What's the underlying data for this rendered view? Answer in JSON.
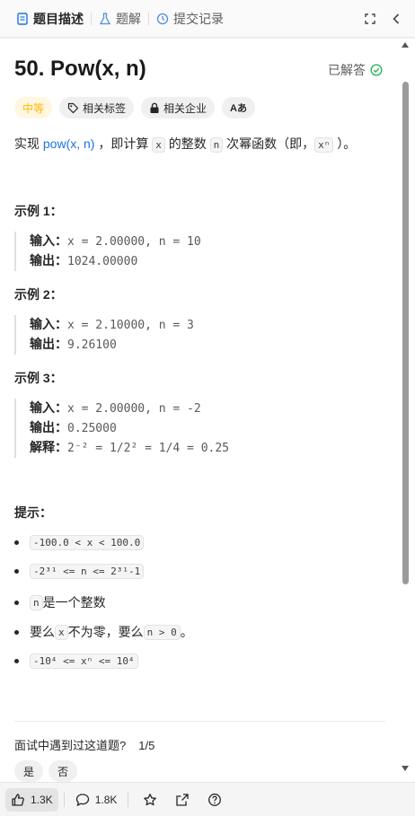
{
  "tabs": [
    {
      "label": "题目描述",
      "icon": "description-icon"
    },
    {
      "label": "题解",
      "icon": "flask-icon"
    },
    {
      "label": "提交记录",
      "icon": "history-icon"
    }
  ],
  "problem": {
    "title": "50. Pow(x, n)",
    "status": "已解答",
    "tags": {
      "difficulty": "中等",
      "related_tags": "相关标签",
      "related_companies": "相关企业",
      "translate": "Aあ"
    },
    "description": {
      "pre": "实现 ",
      "link": "pow(x, n)",
      "mid1": " ，即计算 ",
      "code_x": "x",
      "mid2": " 的整数 ",
      "code_n": "n",
      "mid3": " 次幂函数（即，",
      "code_xn": "xⁿ",
      "post": " ）。"
    }
  },
  "examples": [
    {
      "title": "示例 1：",
      "input_label": "输入：",
      "input": "x = 2.00000, n = 10",
      "output_label": "输出：",
      "output": "1024.00000"
    },
    {
      "title": "示例 2：",
      "input_label": "输入：",
      "input": "x = 2.10000, n = 3",
      "output_label": "输出：",
      "output": "9.26100"
    },
    {
      "title": "示例 3：",
      "input_label": "输入：",
      "input": "x = 2.00000, n = -2",
      "output_label": "输出：",
      "output": "0.25000",
      "explain_label": "解释：",
      "explain": "2⁻² = 1/2² = 1/4 = 0.25"
    }
  ],
  "hints": {
    "title": "提示：",
    "items": [
      {
        "code": "-100.0 < x < 100.0"
      },
      {
        "code": "-2³¹ <= n <= 2³¹-1"
      },
      {
        "code": "n",
        "text": " 是一个整数"
      },
      {
        "pre": "要么 ",
        "code1": "x",
        "mid": " 不为零，要么 ",
        "code2": "n > 0",
        "post": " 。"
      },
      {
        "code": "-10⁴ <= xⁿ <= 10⁴"
      }
    ]
  },
  "interview": {
    "question": "面试中遇到过这道题?",
    "count": "1/5",
    "yes": "是",
    "no": "否"
  },
  "bottombar": {
    "likes": "1.3K",
    "comments": "1.8K"
  }
}
